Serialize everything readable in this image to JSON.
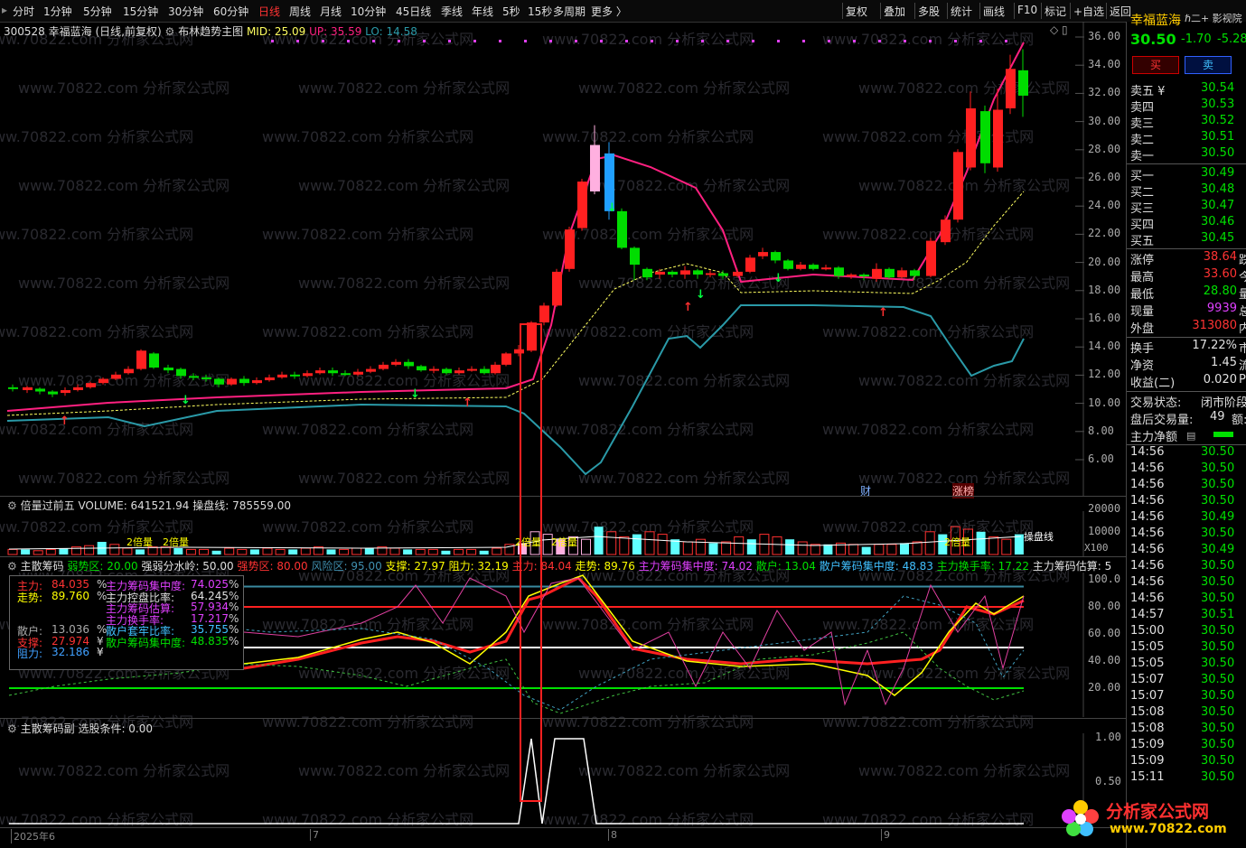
{
  "toolbar": {
    "periods": [
      "分时",
      "1分钟",
      "5分钟",
      "15分钟",
      "30分钟",
      "60分钟",
      "日线",
      "周线",
      "月线",
      "10分钟",
      "45日线",
      "季线",
      "年线",
      "5秒",
      "15秒",
      "多周期",
      "更多 〉"
    ],
    "active_period": "日线",
    "tools": [
      "复权",
      "叠加",
      "多股",
      "统计",
      "画线",
      "F10",
      "标记",
      "+自选",
      "返回"
    ]
  },
  "main_chart": {
    "stock_code": "300528",
    "stock_name": "幸福蓝海",
    "mode": "(日线,前复权)",
    "indicator": "布林趋势主图",
    "mid_label": "MID: 25.09",
    "up_label": "UP: 35.59",
    "lo_label": "LO: 14.58",
    "y_axis": [
      "36.00",
      "34.00",
      "32.00",
      "30.00",
      "28.00",
      "26.00",
      "24.00",
      "22.00",
      "20.00",
      "18.00",
      "16.00",
      "14.00",
      "12.00",
      "10.00",
      "8.00",
      "6.00"
    ],
    "badge_cai": "财",
    "badge_zhangbang": "涨榜"
  },
  "volume_panel": {
    "title": "倍量过前五",
    "volume": "VOLUME: 641521.94",
    "control": "操盘线: 785559.00",
    "y_axis": [
      "20000",
      "10000"
    ],
    "unit": "X100",
    "labels": [
      "2倍量",
      "2倍量",
      "2倍量",
      "2倍量",
      "2倍量"
    ],
    "control_line": "操盘线"
  },
  "chip_panel": {
    "title": "主散筹码",
    "items": [
      {
        "t": "弱势区: 20.00",
        "c": "#00e000"
      },
      {
        "t": "强弱分水岭: 50.00",
        "c": "#e0e0e0"
      },
      {
        "t": "强势区: 80.00",
        "c": "#ff3333"
      },
      {
        "t": "风险区: 95.00",
        "c": "#4090b0"
      },
      {
        "t": "支撑: 27.97",
        "c": "#ffff00"
      },
      {
        "t": "阻力: 32.19",
        "c": "#ffff00"
      },
      {
        "t": "主力: 84.04",
        "c": "#ff3333"
      },
      {
        "t": "走势: 89.76",
        "c": "#ffff00"
      },
      {
        "t": "主力筹码集中度: 74.02",
        "c": "#e040ff"
      },
      {
        "t": "散户: 13.04",
        "c": "#00e000"
      },
      {
        "t": "散户筹码集中度: 48.83",
        "c": "#40c0ff"
      },
      {
        "t": "主力换手率: 17.22",
        "c": "#00e000"
      },
      {
        "t": "主力筹码估算: 5",
        "c": "#e0e0e0"
      }
    ],
    "y_axis": [
      "100.0",
      "80.00",
      "60.00",
      "40.00",
      "20.00"
    ],
    "info": {
      "left": [
        {
          "k": "主力:",
          "v": "84.035",
          "u": "%",
          "c": "#ff3333"
        },
        {
          "k": "走势:",
          "v": "89.760",
          "u": "%",
          "c": "#ffff00"
        },
        {
          "k": "",
          "v": "",
          "u": "",
          "c": "#ccc"
        },
        {
          "k": "",
          "v": "",
          "u": "",
          "c": "#ccc"
        },
        {
          "k": "散户:",
          "v": "13.036",
          "u": "%",
          "c": "#aaa"
        },
        {
          "k": "支撑:",
          "v": "27.974",
          "u": "¥",
          "c": "#ff3333"
        },
        {
          "k": "阻力:",
          "v": "32.186",
          "u": "¥",
          "c": "#40a0ff"
        }
      ],
      "right": [
        {
          "k": "主力筹码集中度:",
          "v": "74.025",
          "u": "%",
          "c": "#e040ff"
        },
        {
          "k": "主力控盘比率:",
          "v": "64.245",
          "u": "%",
          "c": "#e0e0e0"
        },
        {
          "k": "主力筹码估算:",
          "v": "57.934",
          "u": "%",
          "c": "#e040ff"
        },
        {
          "k": "主力换手率:",
          "v": "17.217",
          "u": "%",
          "c": "#e040ff"
        },
        {
          "k": "散户套牢比率:",
          "v": "35.755",
          "u": "%",
          "c": "#40c0ff"
        },
        {
          "k": "散户筹码集中度:",
          "v": "48.835",
          "u": "%",
          "c": "#00e000"
        }
      ]
    }
  },
  "sub_panel": {
    "title": "主散筹码副",
    "condition": "选股条件: 0.00",
    "y_axis": [
      "1.00",
      "0.50"
    ]
  },
  "date_axis": [
    "2025年6",
    "7",
    "8",
    "9"
  ],
  "quote": {
    "name": "幸福蓝海",
    "extra": "ℏ二+ 影视院",
    "price": "30.50",
    "change": "-1.70",
    "pct": "-5.28",
    "buy_btn": "买",
    "sell_btn": "卖",
    "asks": [
      [
        "卖五 ¥",
        "30.54"
      ],
      [
        "卖四",
        "30.53"
      ],
      [
        "卖三",
        "30.52"
      ],
      [
        "卖二",
        "30.51"
      ],
      [
        "卖一",
        "30.50"
      ]
    ],
    "bids": [
      [
        "买一",
        "30.49"
      ],
      [
        "买二",
        "30.48"
      ],
      [
        "买三",
        "30.47"
      ],
      [
        "买四",
        "30.46"
      ],
      [
        "买五",
        "30.45"
      ]
    ],
    "stats": [
      {
        "k": "涨停",
        "v": "38.64",
        "c": "#ff3333",
        "s": "跌"
      },
      {
        "k": "最高",
        "v": "33.60",
        "c": "#ff3333",
        "s": "今"
      },
      {
        "k": "最低",
        "v": "28.80",
        "c": "#00e000",
        "s": "量"
      },
      {
        "k": "现量",
        "v": "9939",
        "c": "#e040ff",
        "s": "总"
      },
      {
        "k": "外盘",
        "v": "313080",
        "c": "#ff3333",
        "s": "内"
      }
    ],
    "stats2": [
      {
        "k": "换手",
        "v": "17.22%",
        "s": "市"
      },
      {
        "k": "净资",
        "v": "1.45",
        "s": "流"
      },
      {
        "k": "收益(二)",
        "v": "0.020",
        "s": "P"
      }
    ],
    "trade_status_k": "交易状态:",
    "trade_status_v": "闭市阶段",
    "after_vol_k": "盘后交易量:",
    "after_vol_v": "49",
    "amount_k": "额:",
    "net_k": "主力净额",
    "ticks": [
      [
        "14:56",
        "30.50"
      ],
      [
        "14:56",
        "30.50"
      ],
      [
        "14:56",
        "30.50"
      ],
      [
        "14:56",
        "30.50"
      ],
      [
        "14:56",
        "30.49"
      ],
      [
        "14:56",
        "30.50"
      ],
      [
        "14:56",
        "30.49"
      ],
      [
        "14:56",
        "30.50"
      ],
      [
        "14:56",
        "30.50"
      ],
      [
        "14:56",
        "30.50"
      ],
      [
        "14:57",
        "30.51"
      ],
      [
        "15:00",
        "30.50"
      ],
      [
        "15:05",
        "30.50"
      ],
      [
        "15:05",
        "30.50"
      ],
      [
        "15:07",
        "30.50"
      ],
      [
        "15:07",
        "30.50"
      ],
      [
        "15:08",
        "30.50"
      ],
      [
        "15:08",
        "30.50"
      ],
      [
        "15:09",
        "30.50"
      ],
      [
        "15:09",
        "30.50"
      ],
      [
        "15:11",
        "30.50"
      ]
    ]
  },
  "logo": {
    "title": "分析家公式网",
    "url": "www.70822.com"
  },
  "watermark": "www.70822.com 分析家公式网",
  "colors": {
    "up": "#ff2020",
    "down": "#00dd00",
    "upper_band": "#ff2080",
    "lower_band": "#2a9aa8",
    "mid": "#ffff60",
    "highlight_box": "#ff2020"
  }
}
